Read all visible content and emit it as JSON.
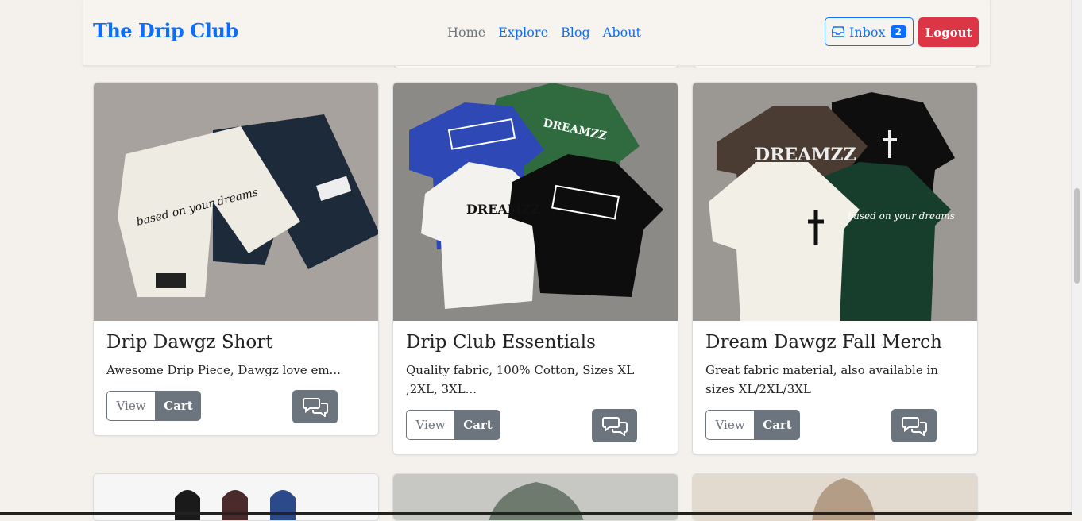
{
  "navbar": {
    "brand": "The Drip Club",
    "links": [
      "Home",
      "Explore",
      "Blog",
      "About"
    ],
    "inbox_label": "Inbox",
    "inbox_count": "2",
    "logout_label": "Logout"
  },
  "products": [
    {
      "title": "Drip Dawgz Short",
      "description": "Awesome Drip Piece, Dawgz love em...",
      "view_label": "View",
      "cart_label": "Cart"
    },
    {
      "title": "Drip Club Essentials",
      "description": "Quality fabric, 100% Cotton, Sizes XL ,2XL, 3XL...",
      "view_label": "View",
      "cart_label": "Cart"
    },
    {
      "title": "Dream Dawgz Fall Merch",
      "description": "Great fabric material, also available in sizes XL/2XL/3XL",
      "view_label": "View",
      "cart_label": "Cart"
    }
  ],
  "colors": {
    "primary": "#0d6efd",
    "danger": "#dc3545",
    "secondary": "#6c757d",
    "background": "#f4f1ec"
  },
  "icons": {
    "inbox": "inbox-icon",
    "chat": "chat-bubbles-icon"
  }
}
